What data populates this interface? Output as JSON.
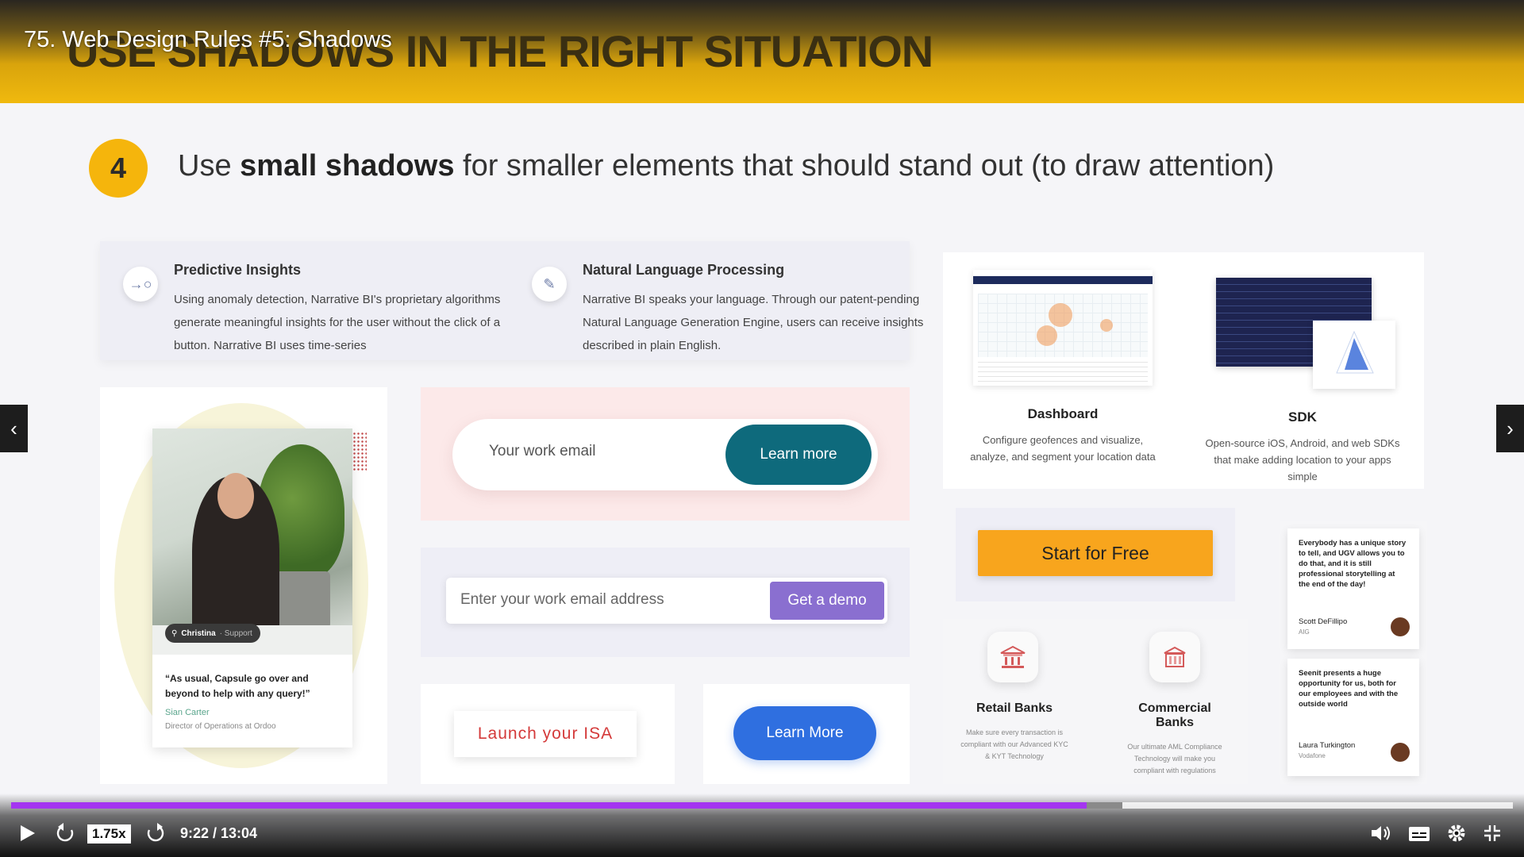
{
  "player_title": "75. Web Design Rules #5: Shadows",
  "slide": {
    "banner_heading": "USE SHADOWS IN THE RIGHT SITUATION",
    "step_number": "4",
    "step_text_pre": "Use ",
    "step_text_bold": "small shadows",
    "step_text_post": " for smaller elements that should stand out (to draw attention)",
    "features": [
      {
        "title": "Predictive Insights",
        "body": "Using anomaly detection, Narrative BI's proprietary algorithms generate meaningful insights for the user without the click of a button. Narrative BI uses time-series",
        "icon": "arrow-right-circle-icon"
      },
      {
        "title": "Natural Language Processing",
        "body": "Narrative BI speaks your language. Through our patent-pending Natural Language Generation Engine, users can receive insights described in plain English.",
        "icon": "pencil-icon"
      }
    ],
    "testimonial": {
      "name_pill": "Christina",
      "name_pill_role": "· Support",
      "quote": "“As usual, Capsule go over and beyond to help with any query!”",
      "author": "Sian Carter",
      "role": "Director of Operations at Ordoo"
    },
    "email_form": {
      "placeholder": "Your work email",
      "button": "Learn more"
    },
    "demo_form": {
      "placeholder": "Enter your work email address",
      "button": "Get a demo"
    },
    "isa_button": "Launch your ISA",
    "learn_more_button": "Learn More",
    "radar": {
      "dashboard_title": "Dashboard",
      "dashboard_desc": "Configure geofences and visualize, analyze, and segment your location data",
      "sdk_title": "SDK",
      "sdk_desc": "Open-source iOS, Android, and web SDKs that make adding location to your apps simple"
    },
    "start_free_button": "Start for Free",
    "banks": [
      {
        "title": "Retail Banks",
        "desc": "Make sure every transaction is compliant with our Advanced KYC & KYT Technology"
      },
      {
        "title": "Commercial Banks",
        "desc": "Our ultimate AML Compliance Technology will make you compliant with regulations"
      }
    ],
    "reviews": [
      {
        "text": "Everybody has a unique story to tell, and UGV allows you to do that, and it is still professional storytelling at the end of the day!",
        "name": "Scott DeFillipo",
        "company": "AIG"
      },
      {
        "text": "Seenit presents a huge opportunity for us, both for our employees and with the outside world",
        "name": "Laura Turkington",
        "company": "Vodafone"
      }
    ]
  },
  "player": {
    "speed": "1.75x",
    "time": "9:22 / 13:04",
    "progress_fraction": 0.716,
    "buffered_fraction": 0.74,
    "accent_color": "#a435f0"
  }
}
